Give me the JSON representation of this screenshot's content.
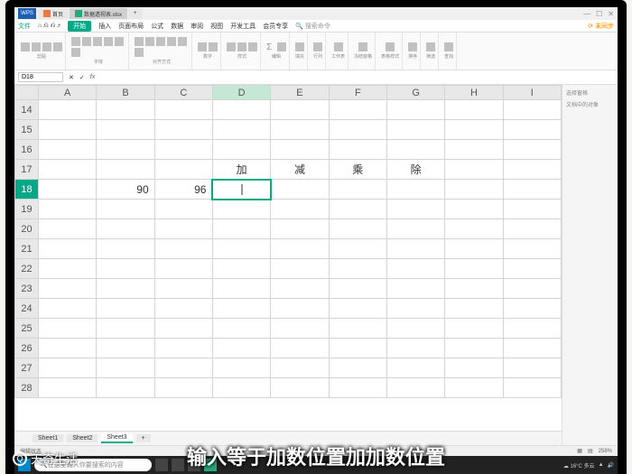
{
  "titlebar": {
    "app": "WPS",
    "doc_name": "数据透视表.xlsx"
  },
  "ribbon": {
    "file": "文件",
    "tabs": [
      "开始",
      "插入",
      "页面布局",
      "公式",
      "数据",
      "审阅",
      "视图",
      "开发工具",
      "会员专享"
    ],
    "active": "开始",
    "search_placeholder": "搜索命令",
    "groups": [
      "剪贴",
      "字体",
      "对齐方式",
      "数字",
      "样式",
      "单元格",
      "编辑",
      "表格样式",
      "填充",
      "行列",
      "工作表",
      "冻结窗格",
      "排序",
      "筛选",
      "查找"
    ]
  },
  "formula_bar": {
    "cell_ref": "D18",
    "fx": "fx",
    "value": ""
  },
  "columns": [
    "A",
    "B",
    "C",
    "D",
    "E",
    "F",
    "G",
    "H",
    "I"
  ],
  "rows": [
    14,
    15,
    16,
    17,
    18,
    19,
    20,
    21,
    22,
    23,
    24,
    25,
    26,
    27,
    28
  ],
  "selected_row": 18,
  "selected_col": "D",
  "cells": {
    "D17": "加",
    "E17": "减",
    "F17": "乘",
    "G17": "除",
    "B18": "90",
    "C18": "96"
  },
  "sheets": {
    "list": [
      "Sheet1",
      "Sheet2",
      "Sheet3"
    ],
    "active": "Sheet3",
    "add": "+"
  },
  "sidepanel": {
    "title": "选择窗格",
    "sub": "文档中的对象"
  },
  "statusbar": {
    "zoom": "258%",
    "mode": "编辑状态"
  },
  "taskbar": {
    "search": "在这里输入你要搜索的内容",
    "weather": "16°C 多云"
  },
  "subtitle": "输入等于加数位置加加数位置",
  "logo": "天奇生活"
}
